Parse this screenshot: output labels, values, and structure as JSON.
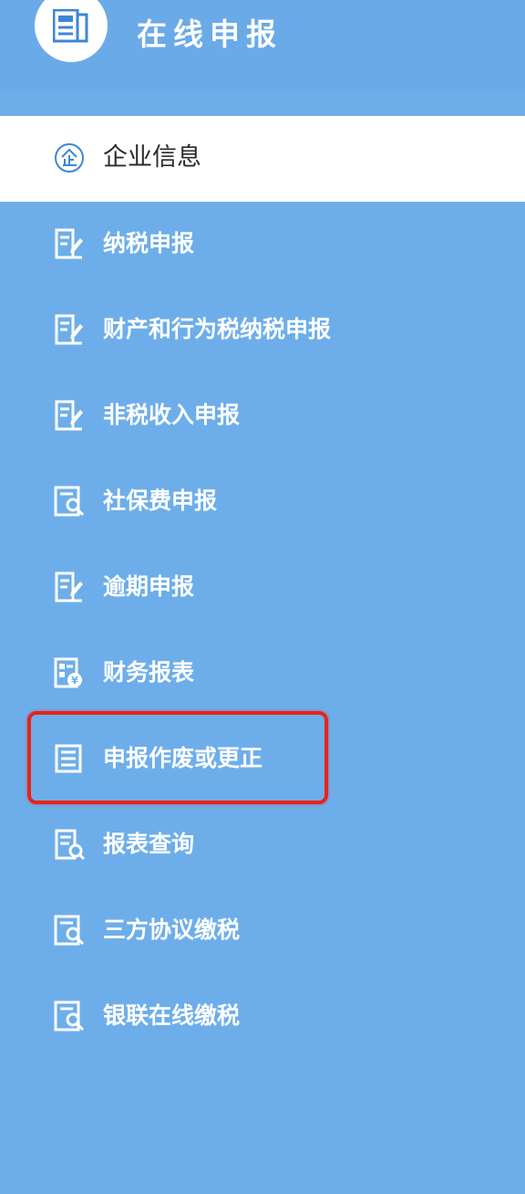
{
  "header": {
    "title": "在线申报",
    "logo_icon": "newspaper-icon"
  },
  "menu": {
    "items": [
      {
        "label": "企业信息",
        "icon": "enterprise-icon",
        "active": true
      },
      {
        "label": "纳税申报",
        "icon": "form-edit-icon"
      },
      {
        "label": "财产和行为税纳税申报",
        "icon": "form-edit-icon"
      },
      {
        "label": "非税收入申报",
        "icon": "form-edit-icon"
      },
      {
        "label": "社保费申报",
        "icon": "form-search-icon"
      },
      {
        "label": "逾期申报",
        "icon": "form-edit-icon"
      },
      {
        "label": "财务报表",
        "icon": "report-icon"
      },
      {
        "label": "申报作废或更正",
        "icon": "document-list-icon",
        "highlighted": true
      },
      {
        "label": "报表查询",
        "icon": "report-query-icon"
      },
      {
        "label": "三方协议缴税",
        "icon": "form-search-icon"
      },
      {
        "label": "银联在线缴税",
        "icon": "form-search-icon"
      }
    ]
  },
  "colors": {
    "background": "#6daeea",
    "active_bg": "#ffffff",
    "highlight": "#e8231c",
    "icon_blue": "#3d86d6"
  }
}
